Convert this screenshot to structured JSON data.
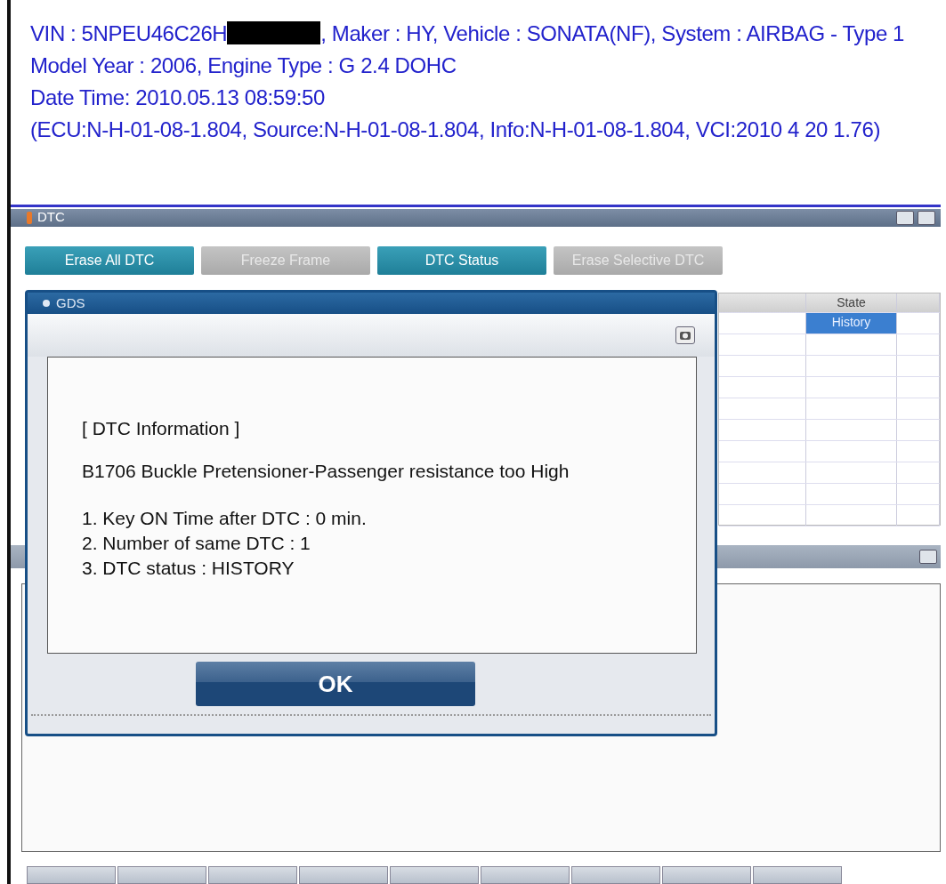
{
  "header": {
    "vin": "VIN : 5NPEU46C26H",
    "redacted": true,
    "vin_rest": ", Maker : HY, Vehicle : SONATA(NF), System : AIRBAG - Type 1",
    "lines": [
      "Model Year : 2006, Engine Type : G 2.4 DOHC",
      "Date Time: 2010.05.13 08:59:50",
      "(ECU:N-H-01-08-1.804, Source:N-H-01-08-1.804, Info:N-H-01-08-1.804, VCI:2010 4 20 1.76)"
    ]
  },
  "dtc_panel": {
    "title": "DTC",
    "buttons": [
      {
        "label": "Erase All DTC",
        "disabled": false
      },
      {
        "label": "Freeze Frame",
        "disabled": true
      },
      {
        "label": "DTC Status",
        "disabled": false
      },
      {
        "label": "Erase Selective DTC",
        "disabled": true
      }
    ],
    "table": {
      "columns": [
        "State"
      ],
      "rows": [
        {
          "state": "History",
          "selected": true
        }
      ]
    }
  },
  "dialog": {
    "title": "GDS",
    "heading": "[ DTC Information ]",
    "description": "B1706 Buckle Pretensioner-Passenger resistance too High",
    "items": [
      "1. Key ON Time after DTC : 0 min.",
      "2. Number of same DTC : 1",
      "3. DTC status : HISTORY"
    ],
    "ok": "OK"
  }
}
